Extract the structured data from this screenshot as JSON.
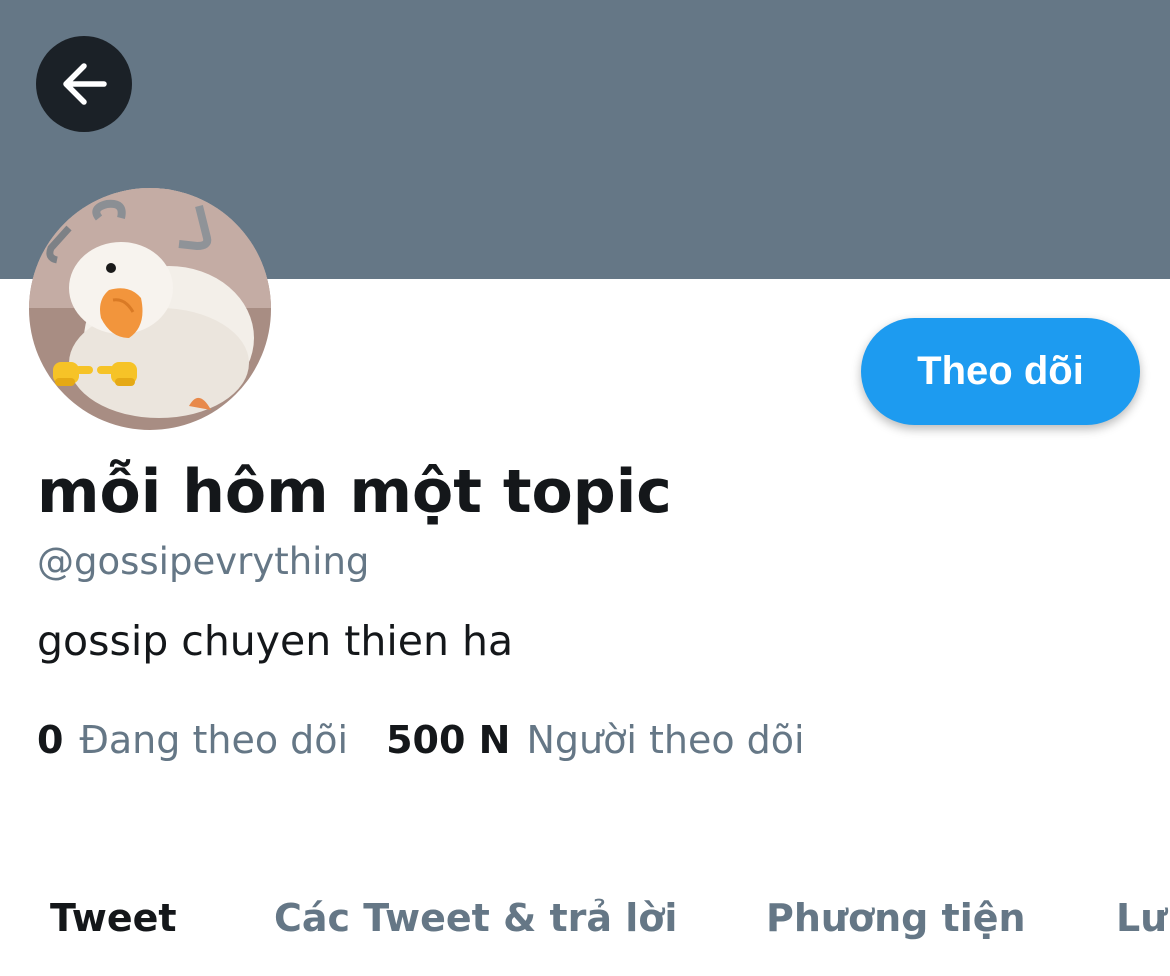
{
  "header": {
    "back_icon": "arrow-left-icon",
    "banner_color": "#657786"
  },
  "profile": {
    "avatar_icon": "duck-avatar",
    "display_name": "mỗi hôm một topic",
    "handle": "@gossipevrything",
    "bio": "gossip chuyen thien ha",
    "follow_label": "Theo dõi",
    "accent_color": "#1d9bf0"
  },
  "stats": [
    {
      "count": "0",
      "label": "Đang theo dõi"
    },
    {
      "count": "500 N",
      "label": "Người theo dõi"
    }
  ],
  "tabs": [
    {
      "label": "Tweet",
      "active": true
    },
    {
      "label": "Các Tweet & trả lời",
      "active": false
    },
    {
      "label": "Phương tiện",
      "active": false
    },
    {
      "label": "Lư",
      "active": false
    }
  ]
}
